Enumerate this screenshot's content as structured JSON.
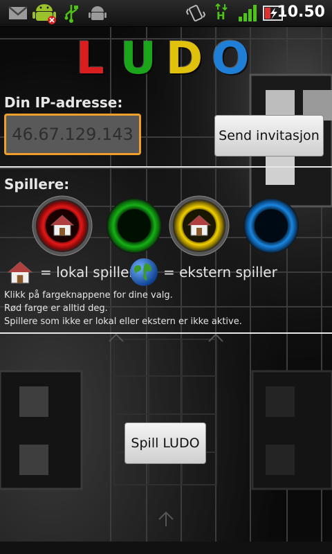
{
  "status_bar": {
    "time": "10.50",
    "network_letter": "H",
    "icons": [
      "gmail-icon",
      "android-notification-icon",
      "usb-icon",
      "android-debug-icon",
      "vibrate-icon",
      "network-type-icon",
      "signal-icon",
      "battery-icon"
    ]
  },
  "logo": {
    "letters": [
      "L",
      "U",
      "D",
      "O"
    ],
    "colors": [
      "#d81e1e",
      "#1aa51a",
      "#e0c20c",
      "#1f7fd6"
    ]
  },
  "ip_section": {
    "label": "Din IP-adresse:",
    "ip_value": "46.67.129.143",
    "send_button": "Send invitasjon"
  },
  "players_section": {
    "label": "Spillere:",
    "players": [
      {
        "color": "red",
        "hex": "#d01010",
        "mode": "local"
      },
      {
        "color": "green",
        "hex": "#12a012",
        "mode": "none"
      },
      {
        "color": "yellow",
        "hex": "#e6c400",
        "mode": "local"
      },
      {
        "color": "blue",
        "hex": "#1a80d8",
        "mode": "none"
      }
    ],
    "legend_local": "= lokal spiller",
    "legend_external": "= ekstern spiller",
    "hints": [
      "Klikk på fargeknappene for dine valg.",
      "Rød farge er alltid deg.",
      "Spillere som ikke er lokal eller ekstern er ikke aktive."
    ]
  },
  "play_button": "Spill LUDO",
  "accent_color": "#f0a028"
}
